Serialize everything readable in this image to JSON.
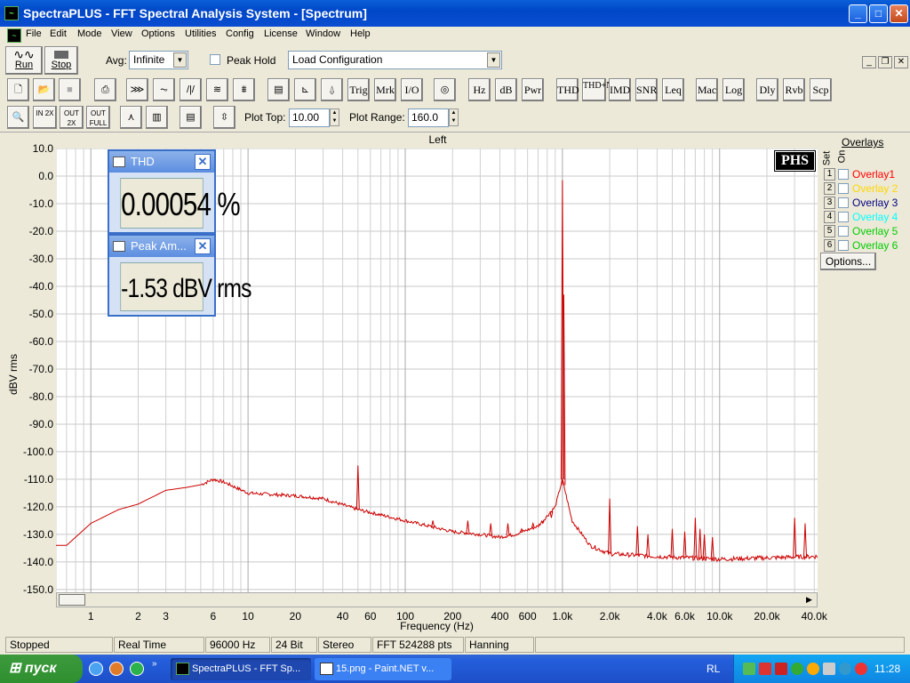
{
  "window": {
    "title": "SpectraPLUS - FFT Spectral Analysis System - [Spectrum]"
  },
  "menu": [
    "File",
    "Edit",
    "Mode",
    "View",
    "Options",
    "Utilities",
    "Config",
    "License",
    "Window",
    "Help"
  ],
  "toolbar1": {
    "run_label": "Run",
    "stop_label": "Stop",
    "avg_label": "Avg:",
    "avg_value": "Infinite",
    "peak_hold_label": "Peak Hold",
    "config_value": "Load Configuration"
  },
  "toolbar2": {
    "buttons": [
      "Trig",
      "Mrk",
      "I/O",
      "Hz",
      "dB",
      "Pwr",
      "THD",
      "THD+N",
      "IMD",
      "SNR",
      "Leq",
      "Mac",
      "Log",
      "Dly",
      "Rvb",
      "Scp"
    ]
  },
  "toolbar3": {
    "zoom_in": "IN 2X",
    "zoom_out": "OUT 2X",
    "full": "OUT FULL",
    "plot_top_label": "Plot Top:",
    "plot_top_value": "10.00",
    "plot_range_label": "Plot Range:",
    "plot_range_value": "160.0"
  },
  "chart_data": {
    "type": "line",
    "title": "Left",
    "xlabel": "Frequency (Hz)",
    "ylabel": "dBV rms",
    "xscale": "log",
    "xlim": [
      0.6,
      42000
    ],
    "ylim": [
      -151,
      10
    ],
    "yticks": [
      "10.0",
      "0.0",
      "-10.0",
      "-20.0",
      "-30.0",
      "-40.0",
      "-50.0",
      "-60.0",
      "-70.0",
      "-80.0",
      "-90.0",
      "-100.0",
      "-110.0",
      "-120.0",
      "-130.0",
      "-140.0",
      "-150.0"
    ],
    "xticks": [
      "1",
      "2",
      "3",
      "6",
      "10",
      "20",
      "40",
      "60",
      "100",
      "200",
      "400",
      "600",
      "1.0k",
      "2.0k",
      "4.0k",
      "6.0k",
      "10.0k",
      "20.0k",
      "40.0k"
    ],
    "xtick_values": [
      1,
      2,
      3,
      6,
      10,
      20,
      40,
      60,
      100,
      200,
      400,
      600,
      1000,
      2000,
      4000,
      6000,
      10000,
      20000,
      40000
    ],
    "color": "#cc0000",
    "floor": [
      [
        0.6,
        -134
      ],
      [
        0.7,
        -134
      ],
      [
        1,
        -126
      ],
      [
        1.5,
        -121
      ],
      [
        2,
        -119
      ],
      [
        3,
        -114
      ],
      [
        4,
        -113
      ],
      [
        5,
        -112
      ],
      [
        6,
        -110
      ],
      [
        7,
        -111
      ],
      [
        10,
        -115
      ],
      [
        20,
        -116
      ],
      [
        30,
        -117
      ],
      [
        50,
        -121
      ],
      [
        100,
        -125
      ],
      [
        200,
        -129
      ],
      [
        300,
        -130
      ],
      [
        400,
        -131
      ],
      [
        500,
        -130
      ],
      [
        700,
        -127
      ],
      [
        900,
        -120
      ],
      [
        1000,
        -110
      ],
      [
        1150,
        -125
      ],
      [
        1500,
        -134
      ],
      [
        2000,
        -137
      ],
      [
        4000,
        -138
      ],
      [
        10000,
        -139
      ],
      [
        40000,
        -138
      ]
    ],
    "peaks": [
      [
        1000,
        -1.5
      ],
      [
        1020,
        -43
      ],
      [
        50,
        -105
      ],
      [
        150,
        -125
      ],
      [
        250,
        -125
      ],
      [
        350,
        -126
      ],
      [
        450,
        -126
      ],
      [
        550,
        -128
      ],
      [
        650,
        -126
      ],
      [
        750,
        -126
      ],
      [
        850,
        -124
      ],
      [
        2000,
        -117
      ],
      [
        3000,
        -127
      ],
      [
        3500,
        -130
      ],
      [
        5000,
        -128
      ],
      [
        6000,
        -129
      ],
      [
        7000,
        -124
      ],
      [
        7500,
        -128
      ],
      [
        8000,
        -130
      ],
      [
        9000,
        -131
      ],
      [
        30000,
        -124
      ],
      [
        35000,
        -126
      ]
    ]
  },
  "meters": [
    {
      "title": "THD",
      "value": "0.00054 %"
    },
    {
      "title": "Peak Am...",
      "value": "-1.53 dBV rms"
    }
  ],
  "logo": "PHS",
  "overlays": {
    "header": "Overlays",
    "set_label": "Set",
    "on_label": "On",
    "options_label": "Options...",
    "items": [
      {
        "num": "1",
        "name": "Overlay1",
        "color": "#ff0000"
      },
      {
        "num": "2",
        "name": "Overlay 2",
        "color": "#ffd700"
      },
      {
        "num": "3",
        "name": "Overlay 3",
        "color": "#000080"
      },
      {
        "num": "4",
        "name": "Overlay 4",
        "color": "#00ffff"
      },
      {
        "num": "5",
        "name": "Overlay 5",
        "color": "#00cc00"
      },
      {
        "num": "6",
        "name": "Overlay 6",
        "color": "#00cc00"
      }
    ]
  },
  "status": [
    "Stopped",
    "Real Time",
    "96000 Hz",
    "24 Bit",
    "Stereo",
    "FFT 524288 pts",
    "Hanning"
  ],
  "taskbar": {
    "start": "пуск",
    "tasks": [
      "SpectraPLUS - FFT Sp...",
      "15.png - Paint.NET v..."
    ],
    "lang": "RL",
    "clock": "11:28"
  }
}
